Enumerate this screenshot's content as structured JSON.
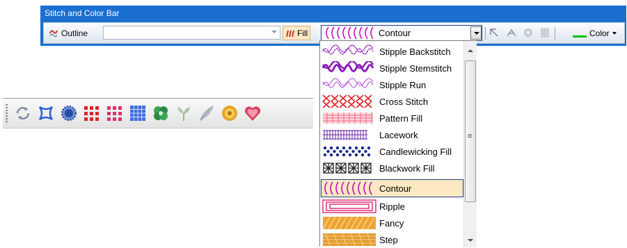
{
  "stitch_bar": {
    "title": "Stitch and Color Bar",
    "outline_label": "Outline",
    "outline_value": "",
    "fill_label": "Fill",
    "fill_value": "Contour",
    "color_label": "Color"
  },
  "fill_dropdown": {
    "items": [
      {
        "label": "Stipple Backstitch",
        "selected": false
      },
      {
        "label": "Stipple Stemstitch",
        "selected": false
      },
      {
        "label": "Stipple Run",
        "selected": false
      },
      {
        "label": "Cross Stitch",
        "selected": false
      },
      {
        "label": "Pattern Fill",
        "selected": false
      },
      {
        "label": "Lacework",
        "selected": false
      },
      {
        "label": "Candlewicking Fill",
        "selected": false
      },
      {
        "label": "Blackwork Fill",
        "selected": false
      },
      {
        "label": "Contour",
        "selected": true
      },
      {
        "label": "Ripple",
        "selected": false
      },
      {
        "label": "Fancy",
        "selected": false
      },
      {
        "label": "Step",
        "selected": false
      }
    ]
  },
  "colors": {
    "title_bar": "#1a6fd0",
    "selection": "#fde9c2",
    "color_swatch": "#00c000"
  },
  "tool_icons": [
    "cycle-icon",
    "outline-shape-icon",
    "lace-icon",
    "cross-stitch-icon",
    "pattern-fill-icon",
    "grid-icon",
    "blackwork-icon",
    "leaf-icon",
    "feather-icon",
    "flower-icon",
    "heart-icon"
  ]
}
